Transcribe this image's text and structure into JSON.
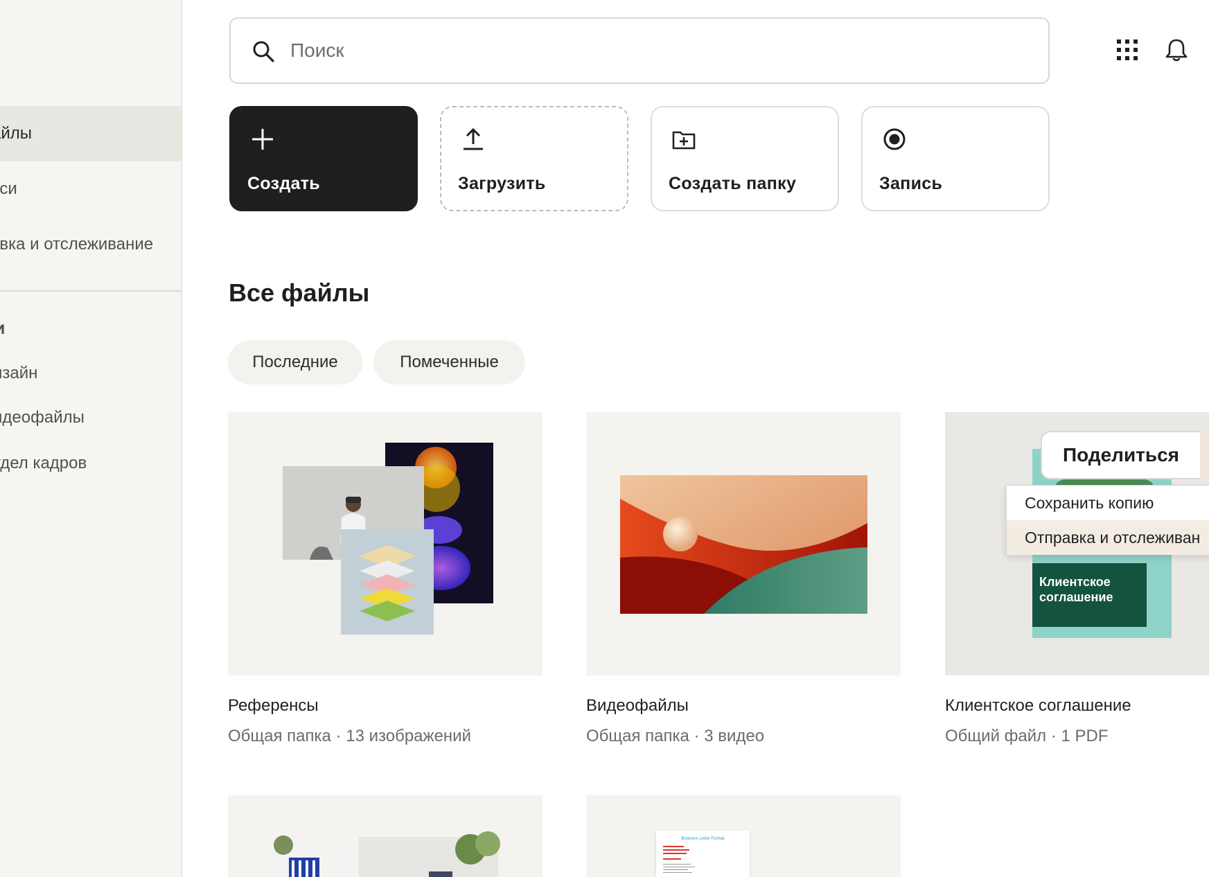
{
  "sidebar": {
    "items": [
      {
        "label": "айлы",
        "active": true
      },
      {
        "label": "иси"
      },
      {
        "label": "авка и отслеживание"
      }
    ],
    "section_title": "и",
    "teams": [
      "изайн",
      "идеофайлы",
      "тдел кадров"
    ]
  },
  "search": {
    "placeholder": "Поиск",
    "value": ""
  },
  "header_icons": [
    "apps-grid-icon",
    "bell-icon"
  ],
  "actions": {
    "create": "Создать",
    "upload": "Загрузить",
    "new_folder": "Создать папку",
    "record": "Запись"
  },
  "main": {
    "title": "Все файлы",
    "filters": [
      "Последние",
      "Помеченные"
    ],
    "cards": [
      {
        "title": "Референсы",
        "meta": "Общая папка · 13 изображений"
      },
      {
        "title": "Видеофайлы",
        "meta": "Общая папка · 3 видео"
      },
      {
        "title": "Клиентское соглашение",
        "meta": "Общий файл · 1 PDF",
        "thumb_text": "Клиентское соглашение"
      }
    ],
    "doc_preview_title": "Business Letter Format"
  },
  "share_popup": {
    "button": "Поделиться",
    "menu": [
      "Сохранить копию",
      "Отправка и отслеживан"
    ]
  },
  "colors": {
    "primary_button": "#1f1f1f",
    "sidebar_bg": "#f6f5f2",
    "highlight": "#f3ece2",
    "agreement_green": "#14533f",
    "agreement_teal": "#8fd3c8"
  }
}
